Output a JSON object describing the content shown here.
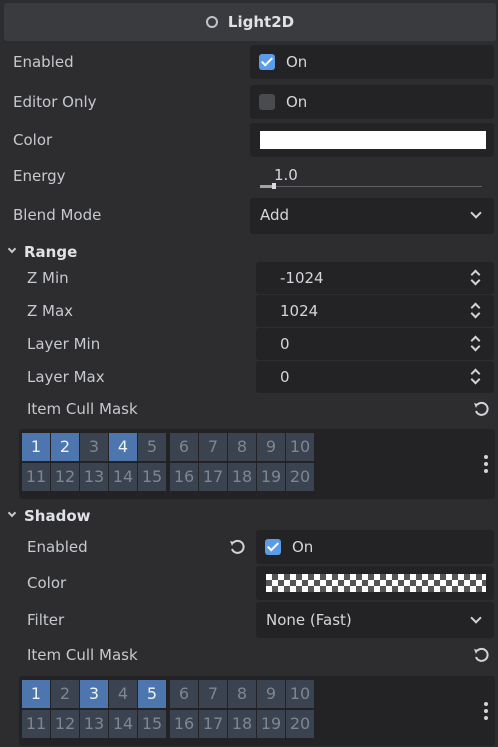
{
  "header": {
    "title": "Light2D",
    "icon": "circle-icon"
  },
  "enabled": {
    "label": "Enabled",
    "checked": true,
    "state_text": "On"
  },
  "editor_only": {
    "label": "Editor Only",
    "checked": false,
    "state_text": "On"
  },
  "color": {
    "label": "Color",
    "value": "#ffffff"
  },
  "energy": {
    "label": "Energy",
    "value": "1.0"
  },
  "blend_mode": {
    "label": "Blend Mode",
    "value": "Add"
  },
  "range": {
    "title": "Range",
    "z_min": {
      "label": "Z Min",
      "value": "-1024"
    },
    "z_max": {
      "label": "Z Max",
      "value": "1024"
    },
    "layer_min": {
      "label": "Layer Min",
      "value": "0"
    },
    "layer_max": {
      "label": "Layer Max",
      "value": "0"
    },
    "item_cull_mask": {
      "label": "Item Cull Mask",
      "layers": [
        "1",
        "2",
        "3",
        "4",
        "5",
        "6",
        "7",
        "8",
        "9",
        "10",
        "11",
        "12",
        "13",
        "14",
        "15",
        "16",
        "17",
        "18",
        "19",
        "20"
      ],
      "selected": [
        "1",
        "2",
        "4"
      ]
    }
  },
  "shadow": {
    "title": "Shadow",
    "enabled": {
      "label": "Enabled",
      "checked": true,
      "state_text": "On"
    },
    "color": {
      "label": "Color"
    },
    "filter": {
      "label": "Filter",
      "value": "None (Fast)"
    },
    "item_cull_mask": {
      "label": "Item Cull Mask",
      "layers": [
        "1",
        "2",
        "3",
        "4",
        "5",
        "6",
        "7",
        "8",
        "9",
        "10",
        "11",
        "12",
        "13",
        "14",
        "15",
        "16",
        "17",
        "18",
        "19",
        "20"
      ],
      "selected": [
        "1",
        "3",
        "5"
      ]
    }
  },
  "colors": {
    "accent": "#5b9ce8",
    "panel_bg": "#2d2d30",
    "field_bg": "#232325",
    "mask_on": "#4c76ad",
    "mask_off": "#3b4351"
  }
}
